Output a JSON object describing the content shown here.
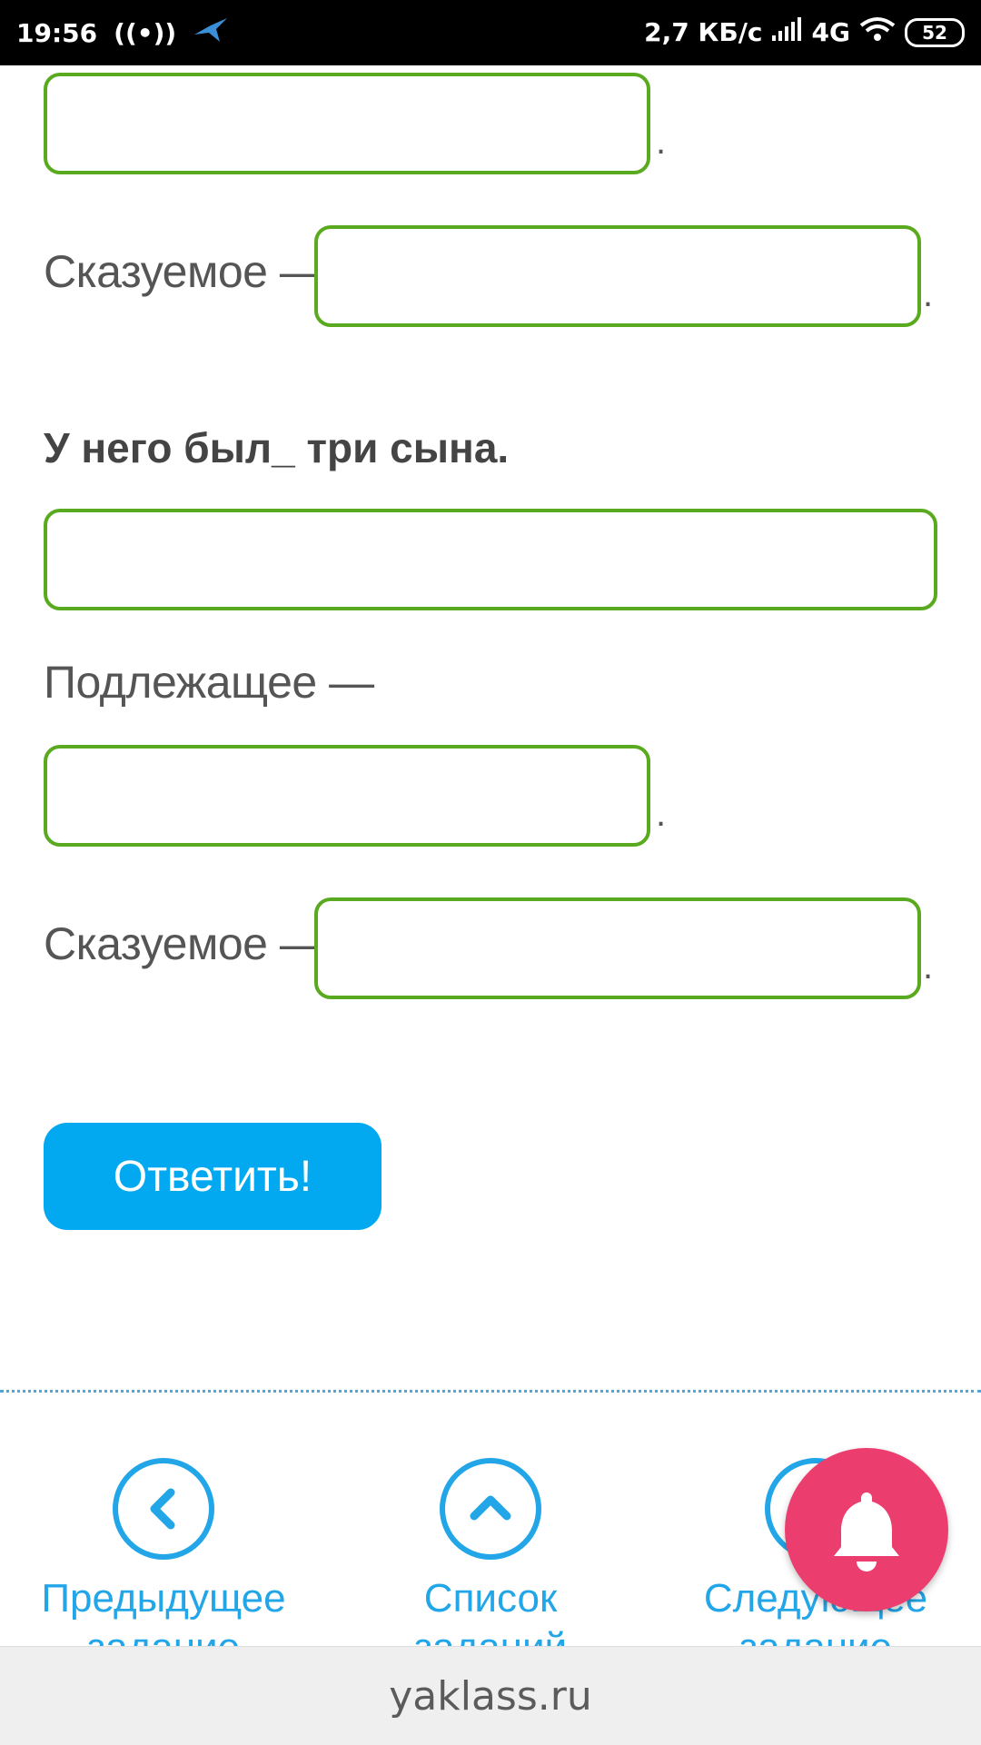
{
  "status_bar": {
    "time": "19:56",
    "network_speed": "2,7 КБ/с",
    "network_type": "4G",
    "battery": "52"
  },
  "form": {
    "predicate_label_1": "Сказуемое —",
    "sentence": "У него был_ три сына.",
    "subject_label": "Подлежащее —",
    "predicate_label_2": "Сказуемое —",
    "period": "."
  },
  "answer_button": {
    "label": "Ответить!"
  },
  "nav": {
    "prev_label": "Предыдущее задание",
    "list_label": "Список заданий",
    "next_label": "Следующее задание"
  },
  "footer": {
    "domain": "yaklass.ru"
  },
  "icons": {
    "prev": "chevron-left-icon",
    "list": "chevron-up-icon",
    "bell": "bell-icon"
  },
  "colors": {
    "field_border": "#5aaa1f",
    "button_bg": "#03a9f0",
    "nav_blue": "#22a6e8",
    "bell_bg": "#ec3e6e"
  }
}
